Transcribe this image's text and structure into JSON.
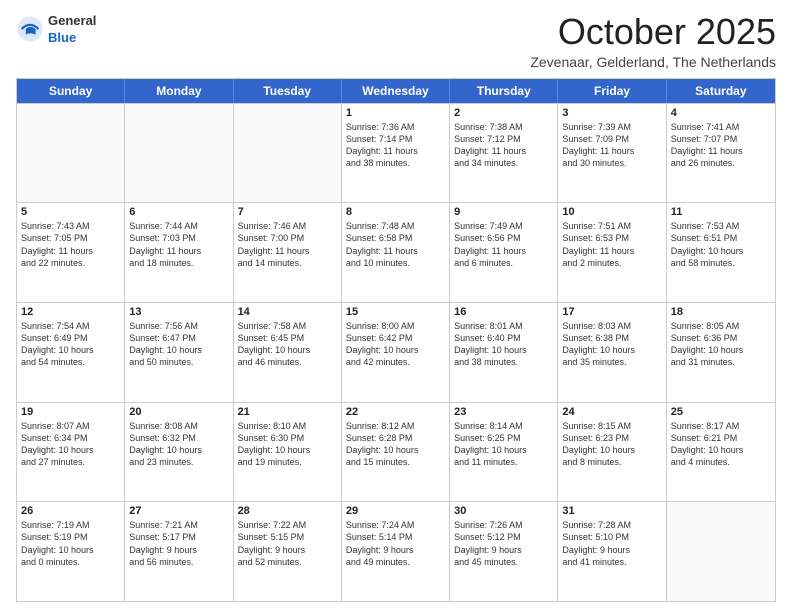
{
  "header": {
    "logo_general": "General",
    "logo_blue": "Blue",
    "month_title": "October 2025",
    "location": "Zevenaar, Gelderland, The Netherlands"
  },
  "days_of_week": [
    "Sunday",
    "Monday",
    "Tuesday",
    "Wednesday",
    "Thursday",
    "Friday",
    "Saturday"
  ],
  "weeks": [
    [
      {
        "day": "",
        "text": "",
        "empty": true
      },
      {
        "day": "",
        "text": "",
        "empty": true
      },
      {
        "day": "",
        "text": "",
        "empty": true
      },
      {
        "day": "1",
        "text": "Sunrise: 7:36 AM\nSunset: 7:14 PM\nDaylight: 11 hours\nand 38 minutes.",
        "empty": false
      },
      {
        "day": "2",
        "text": "Sunrise: 7:38 AM\nSunset: 7:12 PM\nDaylight: 11 hours\nand 34 minutes.",
        "empty": false
      },
      {
        "day": "3",
        "text": "Sunrise: 7:39 AM\nSunset: 7:09 PM\nDaylight: 11 hours\nand 30 minutes.",
        "empty": false
      },
      {
        "day": "4",
        "text": "Sunrise: 7:41 AM\nSunset: 7:07 PM\nDaylight: 11 hours\nand 26 minutes.",
        "empty": false
      }
    ],
    [
      {
        "day": "5",
        "text": "Sunrise: 7:43 AM\nSunset: 7:05 PM\nDaylight: 11 hours\nand 22 minutes.",
        "empty": false
      },
      {
        "day": "6",
        "text": "Sunrise: 7:44 AM\nSunset: 7:03 PM\nDaylight: 11 hours\nand 18 minutes.",
        "empty": false
      },
      {
        "day": "7",
        "text": "Sunrise: 7:46 AM\nSunset: 7:00 PM\nDaylight: 11 hours\nand 14 minutes.",
        "empty": false
      },
      {
        "day": "8",
        "text": "Sunrise: 7:48 AM\nSunset: 6:58 PM\nDaylight: 11 hours\nand 10 minutes.",
        "empty": false
      },
      {
        "day": "9",
        "text": "Sunrise: 7:49 AM\nSunset: 6:56 PM\nDaylight: 11 hours\nand 6 minutes.",
        "empty": false
      },
      {
        "day": "10",
        "text": "Sunrise: 7:51 AM\nSunset: 6:53 PM\nDaylight: 11 hours\nand 2 minutes.",
        "empty": false
      },
      {
        "day": "11",
        "text": "Sunrise: 7:53 AM\nSunset: 6:51 PM\nDaylight: 10 hours\nand 58 minutes.",
        "empty": false
      }
    ],
    [
      {
        "day": "12",
        "text": "Sunrise: 7:54 AM\nSunset: 6:49 PM\nDaylight: 10 hours\nand 54 minutes.",
        "empty": false
      },
      {
        "day": "13",
        "text": "Sunrise: 7:56 AM\nSunset: 6:47 PM\nDaylight: 10 hours\nand 50 minutes.",
        "empty": false
      },
      {
        "day": "14",
        "text": "Sunrise: 7:58 AM\nSunset: 6:45 PM\nDaylight: 10 hours\nand 46 minutes.",
        "empty": false
      },
      {
        "day": "15",
        "text": "Sunrise: 8:00 AM\nSunset: 6:42 PM\nDaylight: 10 hours\nand 42 minutes.",
        "empty": false
      },
      {
        "day": "16",
        "text": "Sunrise: 8:01 AM\nSunset: 6:40 PM\nDaylight: 10 hours\nand 38 minutes.",
        "empty": false
      },
      {
        "day": "17",
        "text": "Sunrise: 8:03 AM\nSunset: 6:38 PM\nDaylight: 10 hours\nand 35 minutes.",
        "empty": false
      },
      {
        "day": "18",
        "text": "Sunrise: 8:05 AM\nSunset: 6:36 PM\nDaylight: 10 hours\nand 31 minutes.",
        "empty": false
      }
    ],
    [
      {
        "day": "19",
        "text": "Sunrise: 8:07 AM\nSunset: 6:34 PM\nDaylight: 10 hours\nand 27 minutes.",
        "empty": false
      },
      {
        "day": "20",
        "text": "Sunrise: 8:08 AM\nSunset: 6:32 PM\nDaylight: 10 hours\nand 23 minutes.",
        "empty": false
      },
      {
        "day": "21",
        "text": "Sunrise: 8:10 AM\nSunset: 6:30 PM\nDaylight: 10 hours\nand 19 minutes.",
        "empty": false
      },
      {
        "day": "22",
        "text": "Sunrise: 8:12 AM\nSunset: 6:28 PM\nDaylight: 10 hours\nand 15 minutes.",
        "empty": false
      },
      {
        "day": "23",
        "text": "Sunrise: 8:14 AM\nSunset: 6:25 PM\nDaylight: 10 hours\nand 11 minutes.",
        "empty": false
      },
      {
        "day": "24",
        "text": "Sunrise: 8:15 AM\nSunset: 6:23 PM\nDaylight: 10 hours\nand 8 minutes.",
        "empty": false
      },
      {
        "day": "25",
        "text": "Sunrise: 8:17 AM\nSunset: 6:21 PM\nDaylight: 10 hours\nand 4 minutes.",
        "empty": false
      }
    ],
    [
      {
        "day": "26",
        "text": "Sunrise: 7:19 AM\nSunset: 5:19 PM\nDaylight: 10 hours\nand 0 minutes.",
        "empty": false
      },
      {
        "day": "27",
        "text": "Sunrise: 7:21 AM\nSunset: 5:17 PM\nDaylight: 9 hours\nand 56 minutes.",
        "empty": false
      },
      {
        "day": "28",
        "text": "Sunrise: 7:22 AM\nSunset: 5:15 PM\nDaylight: 9 hours\nand 52 minutes.",
        "empty": false
      },
      {
        "day": "29",
        "text": "Sunrise: 7:24 AM\nSunset: 5:14 PM\nDaylight: 9 hours\nand 49 minutes.",
        "empty": false
      },
      {
        "day": "30",
        "text": "Sunrise: 7:26 AM\nSunset: 5:12 PM\nDaylight: 9 hours\nand 45 minutes.",
        "empty": false
      },
      {
        "day": "31",
        "text": "Sunrise: 7:28 AM\nSunset: 5:10 PM\nDaylight: 9 hours\nand 41 minutes.",
        "empty": false
      },
      {
        "day": "",
        "text": "",
        "empty": true
      }
    ]
  ]
}
